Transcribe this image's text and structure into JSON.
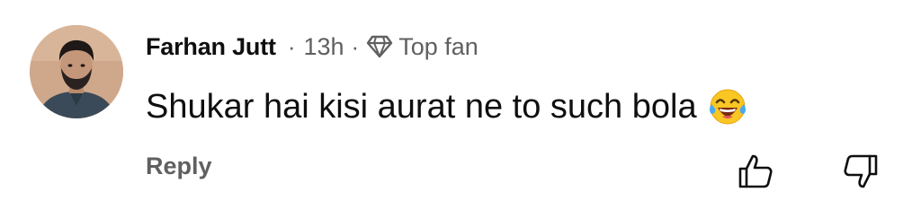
{
  "comment": {
    "author": "Farhan Jutt",
    "separator": "·",
    "time": "13h",
    "badge_label": "Top fan",
    "badge_icon": "diamond-icon",
    "text": "Shukar hai kisi aurat ne to such bola",
    "emoji": "face-with-tears-of-joy",
    "reply_label": "Reply",
    "actions": {
      "like_icon": "thumbs-up-icon",
      "dislike_icon": "thumbs-down-icon"
    }
  },
  "colors": {
    "primary_text": "#0f0f0f",
    "secondary_text": "#606060",
    "background": "#ffffff"
  }
}
